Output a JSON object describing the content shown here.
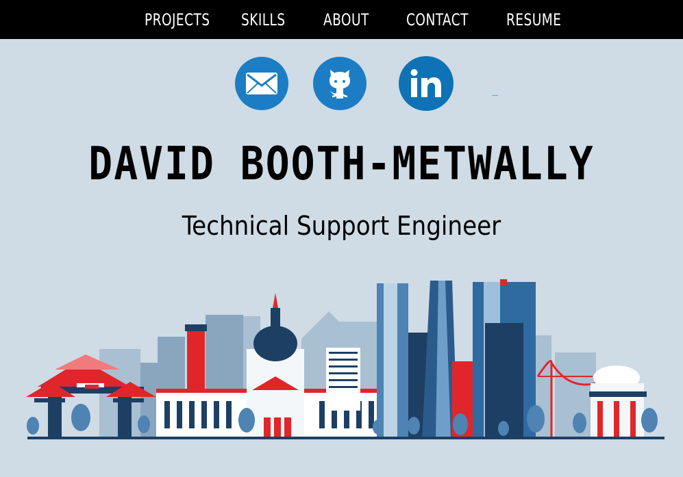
{
  "nav": {
    "items": [
      "PROJECTS",
      "SKILLS",
      "ABOUT",
      "CONTACT",
      "RESUME"
    ]
  },
  "social": [
    {
      "icon": "mail-icon",
      "color": "#1c7dc5"
    },
    {
      "icon": "github-icon",
      "color": "#1c7dc5"
    },
    {
      "icon": "linkedin-icon",
      "color": "#0f72b4"
    }
  ],
  "hero": {
    "name": "DAVID BOOTH-METWALLY",
    "title": "Technical Support Engineer"
  },
  "colors": {
    "background": "#cfdbe5",
    "navbar": "#000000",
    "accent_blue": "#1c7dc5",
    "skyline_navy": "#1d3f64",
    "skyline_red": "#e0262b"
  }
}
